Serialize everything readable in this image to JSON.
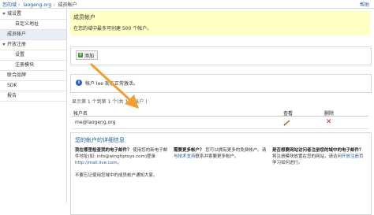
{
  "header": {
    "breadcrumb": [
      "您的域",
      "laogeng.org",
      "成员帐户"
    ],
    "help": "帮助"
  },
  "sidebar": {
    "items": [
      {
        "label": "域设置",
        "level": 0,
        "expandable": true,
        "selected": false
      },
      {
        "label": "自定义地址",
        "level": 1,
        "expandable": false,
        "selected": false
      },
      {
        "label": "成员帐户",
        "level": 0,
        "expandable": false,
        "selected": true
      },
      {
        "label": "开放注册",
        "level": 0,
        "expandable": true,
        "selected": false
      },
      {
        "label": "设置",
        "level": 1,
        "expandable": false,
        "selected": false
      },
      {
        "label": "注册模块",
        "level": 1,
        "expandable": false,
        "selected": false
      },
      {
        "label": "联合品牌",
        "level": 0,
        "expandable": false,
        "selected": false
      },
      {
        "label": "SDK",
        "level": 0,
        "expandable": false,
        "selected": false
      },
      {
        "label": "报告",
        "level": 0,
        "expandable": false,
        "selected": false
      }
    ]
  },
  "page": {
    "title": "成员帐户",
    "subtitle": "在您的域中最多可创建 500 个帐户。"
  },
  "toolbar": {
    "add_label": "添加"
  },
  "info": {
    "message": "帐户 lee 现在正常激活。"
  },
  "list": {
    "count_text": "显示第 1 个到第 1 个(共 1 个帐户 )",
    "columns": {
      "account": "帐户名",
      "view": "查看",
      "delete": "删除"
    },
    "rows": [
      {
        "email": "me@laogeng.org"
      }
    ]
  },
  "details": {
    "title": "您的帐户的详细信息",
    "col1": {
      "heading": "我在哪里检查我的电子邮件？",
      "text": "使用您的新电子邮件地址(如: info@wingtiptoys.com)登录",
      "link": "http://mail.live.com",
      "tail": "。",
      "note": "不要忘记使用您域中的成员帐户通知大家。"
    },
    "col2": {
      "heading": "需要更多帐户？",
      "text_a": "您可以拥有更多的免费帐户。请与",
      "link": "技术支持",
      "text_b": "联系并索要更多帐户。"
    },
    "col3": {
      "heading": "是否想要网站访问者注册您的域中的电子邮件？",
      "text_a": "将注册模块放置在您的网站，请访问",
      "link": "开放注册",
      "text_b": "页学习如何进行。"
    }
  },
  "colors": {
    "accent": "#1f5aa6",
    "highlight": "#ffffc4",
    "selected_bg": "#e8eef7",
    "arrow": "#f0a030",
    "delete": "#dd2222"
  }
}
